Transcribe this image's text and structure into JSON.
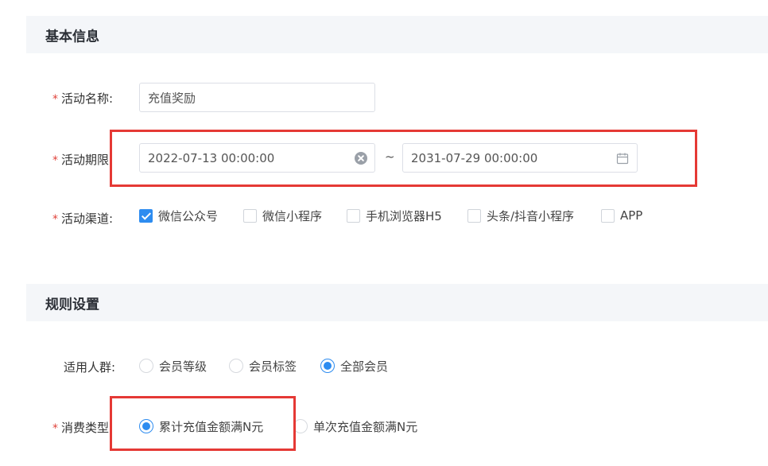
{
  "sections": {
    "basic": {
      "title": "基本信息"
    },
    "rules": {
      "title": "规则设置"
    }
  },
  "form": {
    "required_mark": "*",
    "activity_name": {
      "label": "活动名称:",
      "value": "充值奖励"
    },
    "activity_period": {
      "label": "活动期限:",
      "start": "2022-07-13 00:00:00",
      "separator": "~",
      "end": "2031-07-29 00:00:00"
    },
    "activity_channel": {
      "label": "活动渠道:",
      "options": [
        {
          "label": "微信公众号",
          "checked": true
        },
        {
          "label": "微信小程序",
          "checked": false
        },
        {
          "label": "手机浏览器H5",
          "checked": false
        },
        {
          "label": "头条/抖音小程序",
          "checked": false
        },
        {
          "label": "APP",
          "checked": false
        }
      ]
    },
    "target_group": {
      "label": "适用人群:",
      "options": [
        {
          "label": "会员等级",
          "checked": false
        },
        {
          "label": "会员标签",
          "checked": false
        },
        {
          "label": "全部会员",
          "checked": true
        }
      ]
    },
    "consume_type": {
      "label": "消费类型:",
      "options": [
        {
          "label": "累计充值金额满N元",
          "checked": true
        },
        {
          "label": "单次充值金额满N元",
          "checked": false
        }
      ]
    }
  },
  "icons": {
    "clear": "clear-icon",
    "calendar": "calendar-icon",
    "check": "check-icon"
  },
  "colors": {
    "accent": "#2d8cf0",
    "required": "#e0433b",
    "highlight": "#e53935",
    "section_bg": "#f4f6f9"
  }
}
